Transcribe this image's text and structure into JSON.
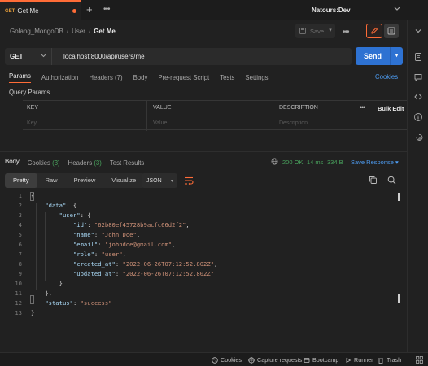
{
  "tabs": {
    "active": {
      "method": "GET",
      "title": "Get Me"
    },
    "environment": "Natours:Dev"
  },
  "breadcrumb": {
    "items": [
      "Golang_MongoDB",
      "User"
    ],
    "current": "Get Me"
  },
  "toolbar": {
    "save_label": "Save"
  },
  "request": {
    "method": "GET",
    "url": "localhost:8000/api/users/me",
    "send_label": "Send"
  },
  "req_tabs": [
    {
      "label": "Params",
      "count": ""
    },
    {
      "label": "Authorization",
      "count": ""
    },
    {
      "label": "Headers",
      "count": "(7)"
    },
    {
      "label": "Body",
      "count": ""
    },
    {
      "label": "Pre-request Script",
      "count": ""
    },
    {
      "label": "Tests",
      "count": ""
    },
    {
      "label": "Settings",
      "count": ""
    }
  ],
  "cookies_link": "Cookies",
  "query_params": {
    "title": "Query Params",
    "columns": [
      "KEY",
      "VALUE",
      "DESCRIPTION"
    ],
    "placeholders": [
      "Key",
      "Value",
      "Description"
    ],
    "bulk_edit": "Bulk Edit"
  },
  "response": {
    "tabs": [
      {
        "label": "Body",
        "count": ""
      },
      {
        "label": "Cookies",
        "count": "(3)"
      },
      {
        "label": "Headers",
        "count": "(3)"
      },
      {
        "label": "Test Results",
        "count": ""
      }
    ],
    "status": "200 OK",
    "time": "14 ms",
    "size": "334 B",
    "save_label": "Save Response",
    "view_tabs": [
      "Pretty",
      "Raw",
      "Preview",
      "Visualize"
    ],
    "format": "JSON",
    "lines": [
      "1",
      "2",
      "3",
      "4",
      "5",
      "6",
      "7",
      "8",
      "9",
      "10",
      "11",
      "12",
      "13"
    ],
    "json": {
      "id": "62b80ef45728b9acfc66d2f2",
      "name": "John Doe",
      "email": "johndoe@gmail.com",
      "role": "user",
      "created_at": "2022-06-26T07:12:52.802Z",
      "updated_at": "2022-06-26T07:12:52.802Z",
      "status": "success"
    }
  },
  "footer": {
    "items": [
      "Cookies",
      "Capture requests",
      "Bootcamp",
      "Runner",
      "Trash"
    ]
  },
  "colors": {
    "accent": "#ff6c37",
    "send": "#2e72d2",
    "success": "#49a35d",
    "link": "#4d9bf0"
  }
}
